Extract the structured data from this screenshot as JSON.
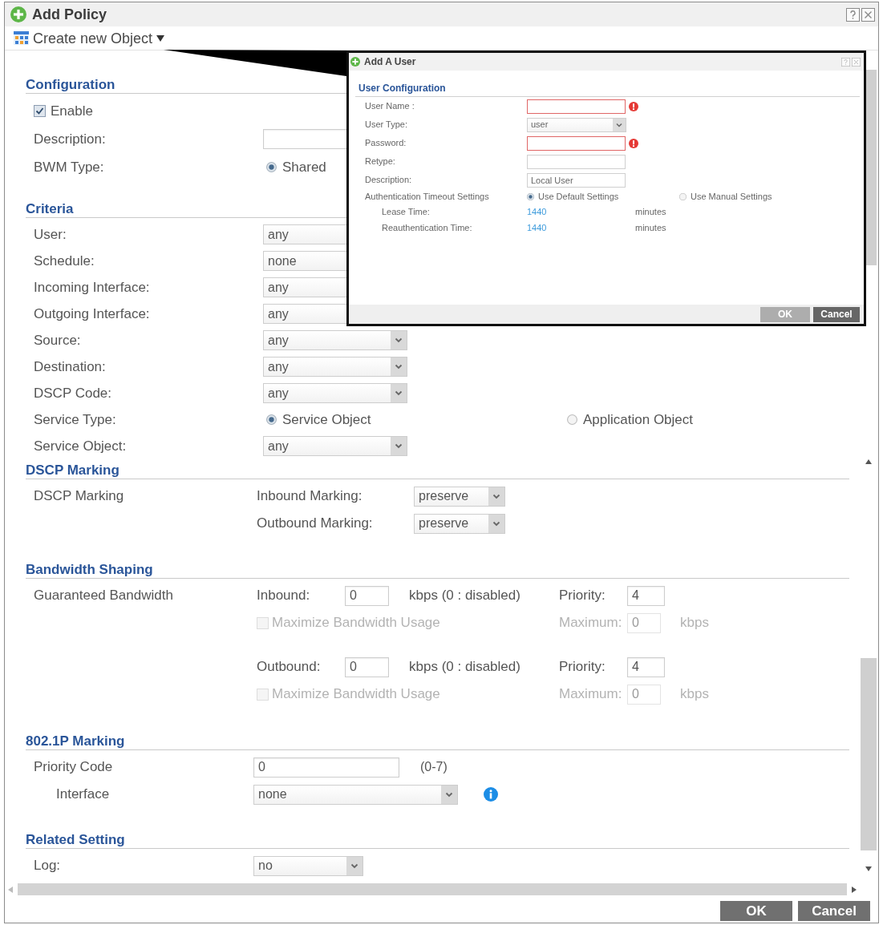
{
  "window": {
    "title": "Add Policy"
  },
  "toolbar": {
    "menu": "Create new Object"
  },
  "sections": [
    {
      "title": "Configuration",
      "rows": [
        {
          "kind": "checkbox",
          "label": "Enable",
          "checked": true
        },
        {
          "kind": "input",
          "label": "Description:"
        },
        {
          "kind": "radio",
          "label": "BWM Type:",
          "options": [
            {
              "label": "Shared",
              "selected": true
            }
          ]
        }
      ]
    },
    {
      "title": "Criteria",
      "rows": [
        {
          "kind": "select",
          "label": "User:",
          "value": "any"
        },
        {
          "kind": "select",
          "label": "Schedule:",
          "value": "none"
        },
        {
          "kind": "select",
          "label": "Incoming Interface:",
          "value": "any"
        },
        {
          "kind": "select",
          "label": "Outgoing Interface:",
          "value": "any"
        },
        {
          "kind": "select",
          "label": "Source:",
          "value": "any"
        },
        {
          "kind": "select",
          "label": "Destination:",
          "value": "any"
        },
        {
          "kind": "select",
          "label": "DSCP Code:",
          "value": "any"
        },
        {
          "kind": "radio",
          "label": "Service Type:",
          "options": [
            {
              "label": "Service Object",
              "selected": true
            },
            {
              "label": "Application Object",
              "selected": false
            }
          ]
        },
        {
          "kind": "select",
          "label": "Service Object:",
          "value": "any"
        }
      ]
    },
    {
      "title": "DSCP Marking",
      "rows": [
        {
          "kind": "marking",
          "label": "DSCP Marking",
          "fields": [
            {
              "label": "Inbound Marking:",
              "value": "preserve"
            },
            {
              "label": "Outbound Marking:",
              "value": "preserve"
            }
          ]
        }
      ]
    },
    {
      "title": "Bandwidth Shaping",
      "rows": [
        {
          "kind": "bandwidth",
          "label": "Guaranteed Bandwidth",
          "directions": [
            {
              "label": "Inbound:",
              "value": "0",
              "note": "kbps (0 : disabled)",
              "priority_label": "Priority:",
              "priority": "4",
              "maximize": {
                "label": "Maximize Bandwidth Usage",
                "checked": false,
                "disabled": true
              },
              "maximum": {
                "label": "Maximum:",
                "value": "0",
                "unit": "kbps",
                "disabled": true
              }
            },
            {
              "label": "Outbound:",
              "value": "0",
              "note": "kbps (0 : disabled)",
              "priority_label": "Priority:",
              "priority": "4",
              "maximize": {
                "label": "Maximize Bandwidth Usage",
                "checked": false,
                "disabled": true
              },
              "maximum": {
                "label": "Maximum:",
                "value": "0",
                "unit": "kbps",
                "disabled": true
              }
            }
          ]
        }
      ]
    },
    {
      "title": "802.1P Marking",
      "rows": [
        {
          "kind": "input",
          "label": "Priority Code",
          "value": "0",
          "hint": "(0-7)"
        },
        {
          "kind": "select",
          "label": "Interface",
          "value": "none",
          "info": true
        }
      ]
    },
    {
      "title": "Related Setting",
      "rows": [
        {
          "kind": "select",
          "label": "Log:",
          "value": "no"
        }
      ]
    }
  ],
  "dialog": {
    "title": "Add A User",
    "heading": "User Configuration",
    "rows": [
      {
        "kind": "input",
        "label": "User Name :",
        "required": true
      },
      {
        "kind": "select",
        "label": "User Type:",
        "value": "user"
      },
      {
        "kind": "input",
        "label": "Password:",
        "required": true
      },
      {
        "kind": "input",
        "label": "Retype:",
        "required": false
      },
      {
        "kind": "input",
        "label": "Description:",
        "value": "Local User",
        "required": false
      },
      {
        "kind": "radio",
        "label": "Authentication Timeout Settings",
        "options": [
          {
            "label": "Use Default Settings",
            "selected": true
          },
          {
            "label": "Use Manual Settings",
            "selected": false
          }
        ]
      },
      {
        "kind": "reading",
        "label": "Lease Time:",
        "value": "1440",
        "unit": "minutes"
      },
      {
        "kind": "reading",
        "label": "Reauthentication Time:",
        "value": "1440",
        "unit": "minutes"
      }
    ],
    "buttons": [
      {
        "label": "OK",
        "disabled": true
      },
      {
        "label": "Cancel",
        "disabled": false
      }
    ]
  },
  "buttons": [
    "OK",
    "Cancel"
  ]
}
